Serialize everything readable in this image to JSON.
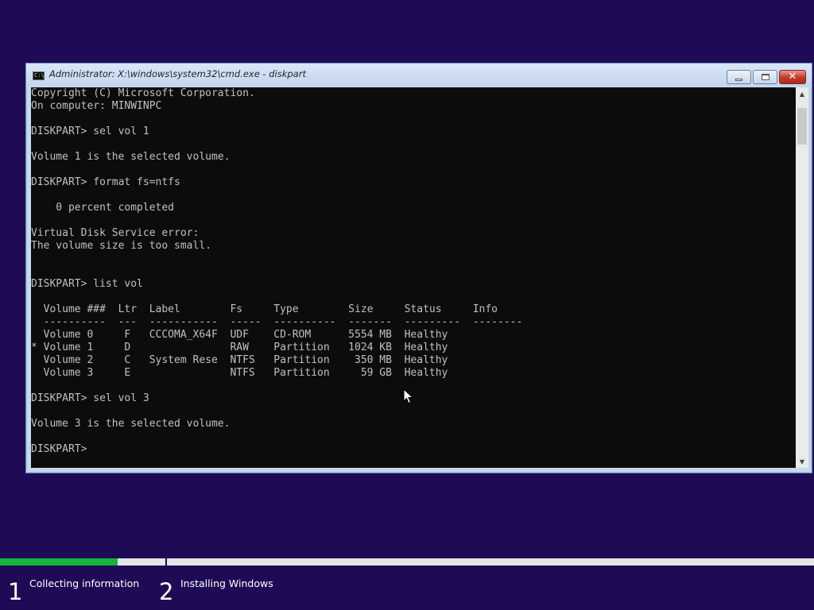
{
  "window": {
    "title": "Administrator: X:\\windows\\system32\\cmd.exe - diskpart",
    "icon_label": "C:\\",
    "buttons": {
      "minimize": "minimize-icon",
      "maximize": "maximize-icon",
      "close": "close-icon"
    }
  },
  "console": {
    "lines": [
      "Copyright (C) Microsoft Corporation.",
      "On computer: MINWINPC",
      "",
      "DISKPART> sel vol 1",
      "",
      "Volume 1 is the selected volume.",
      "",
      "DISKPART> format fs=ntfs",
      "",
      "    0 percent completed",
      "",
      "Virtual Disk Service error:",
      "The volume size is too small.",
      "",
      "",
      "DISKPART> list vol",
      "",
      "  Volume ###  Ltr  Label        Fs     Type        Size     Status     Info",
      "  ----------  ---  -----------  -----  ----------  -------  ---------  --------",
      "  Volume 0     F   CCCOMA_X64F  UDF    CD-ROM      5554 MB  Healthy",
      "* Volume 1     D                RAW    Partition   1024 KB  Healthy",
      "  Volume 2     C   System Rese  NTFS   Partition    350 MB  Healthy",
      "  Volume 3     E                NTFS   Partition     59 GB  Healthy",
      "",
      "DISKPART> sel vol 3",
      "",
      "Volume 3 is the selected volume.",
      "",
      "DISKPART> "
    ],
    "colors": {
      "background": "#0c0c0c",
      "text": "#c0c0c0"
    }
  },
  "setup": {
    "progress": 0.145,
    "steps": [
      {
        "number": "1",
        "label": "Collecting information"
      },
      {
        "number": "2",
        "label": "Installing Windows"
      }
    ],
    "colors": {
      "background": "#1f0a55",
      "progress": "#19b43c"
    }
  }
}
